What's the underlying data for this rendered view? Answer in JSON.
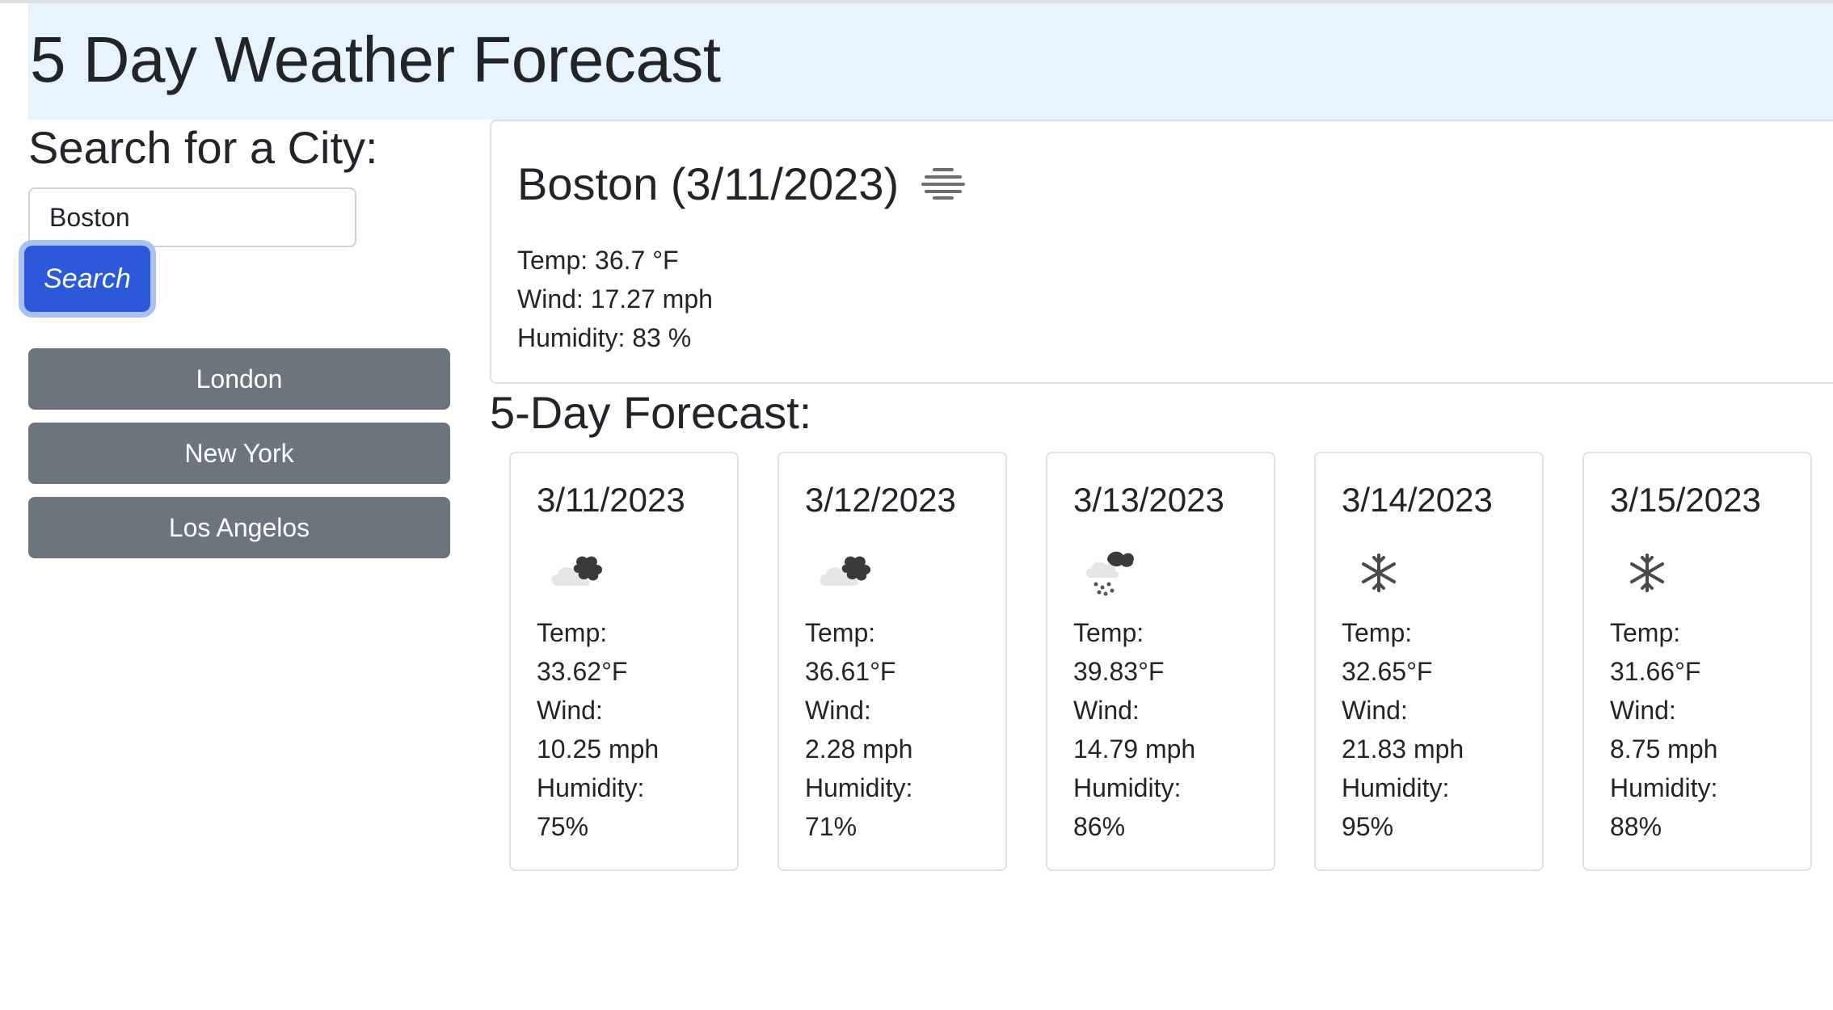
{
  "header": {
    "title": "5 Day Weather Forecast"
  },
  "search": {
    "title": "Search for a City:",
    "input_value": "Boston",
    "button_label": "Search"
  },
  "history": [
    {
      "label": "London"
    },
    {
      "label": "New York"
    },
    {
      "label": "Los Angelos"
    }
  ],
  "current": {
    "title": "Boston (3/11/2023)",
    "icon": "mist-icon",
    "temp": "Temp: 36.7 °F",
    "wind": "Wind: 17.27 mph",
    "humidity": "Humidity: 83 %"
  },
  "forecast": {
    "title": "5-Day Forecast:",
    "temp_label": "Temp:",
    "wind_label": "Wind:",
    "humidity_label": "Humidity:",
    "days": [
      {
        "date": "3/11/2023",
        "icon": "broken-clouds-icon",
        "temp": "33.62°F",
        "wind": "10.25 mph",
        "humidity": "75%"
      },
      {
        "date": "3/12/2023",
        "icon": "broken-clouds-icon",
        "temp": "36.61°F",
        "wind": "2.28 mph",
        "humidity": "71%"
      },
      {
        "date": "3/13/2023",
        "icon": "rain-snow-icon",
        "temp": "39.83°F",
        "wind": "14.79 mph",
        "humidity": "86%"
      },
      {
        "date": "3/14/2023",
        "icon": "snow-icon",
        "temp": "32.65°F",
        "wind": "21.83 mph",
        "humidity": "95%"
      },
      {
        "date": "3/15/2023",
        "icon": "snow-icon",
        "temp": "31.66°F",
        "wind": "8.75 mph",
        "humidity": "88%"
      }
    ]
  }
}
